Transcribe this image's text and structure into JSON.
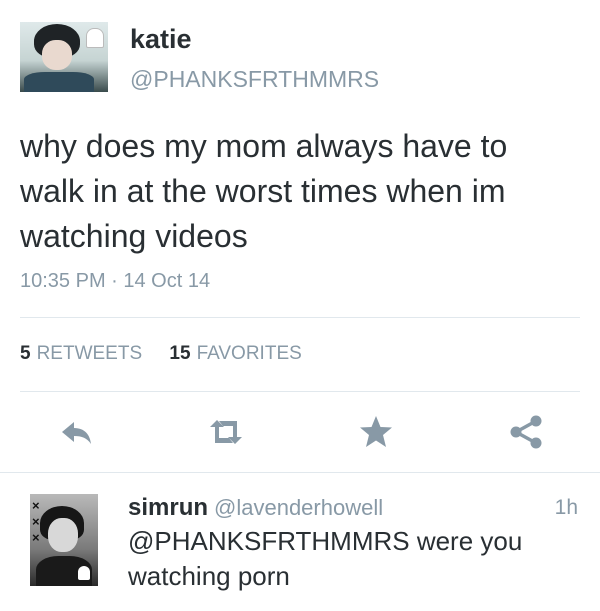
{
  "tweet": {
    "author_name": "katie",
    "author_handle": "@PHANKSFRTHMMRS",
    "text": "why does my mom always have to walk in at the worst times when im watching videos",
    "timestamp": "10:35 PM · 14 Oct 14"
  },
  "stats": {
    "retweets_count": "5",
    "retweets_label": "RETWEETS",
    "favorites_count": "15",
    "favorites_label": "FAVORITES"
  },
  "actions": {
    "icons": [
      "reply-icon",
      "retweet-icon",
      "star-icon",
      "share-icon"
    ]
  },
  "reply": {
    "author_name": "simrun",
    "author_handle": "@lavenderhowell",
    "time": "1h",
    "text": "@PHANKSFRTHMMRS were you watching porn"
  },
  "colors": {
    "text_primary": "#292f33",
    "text_secondary": "#8899a6",
    "icon_color": "#8899a6",
    "divider": "#e1e8ed"
  }
}
